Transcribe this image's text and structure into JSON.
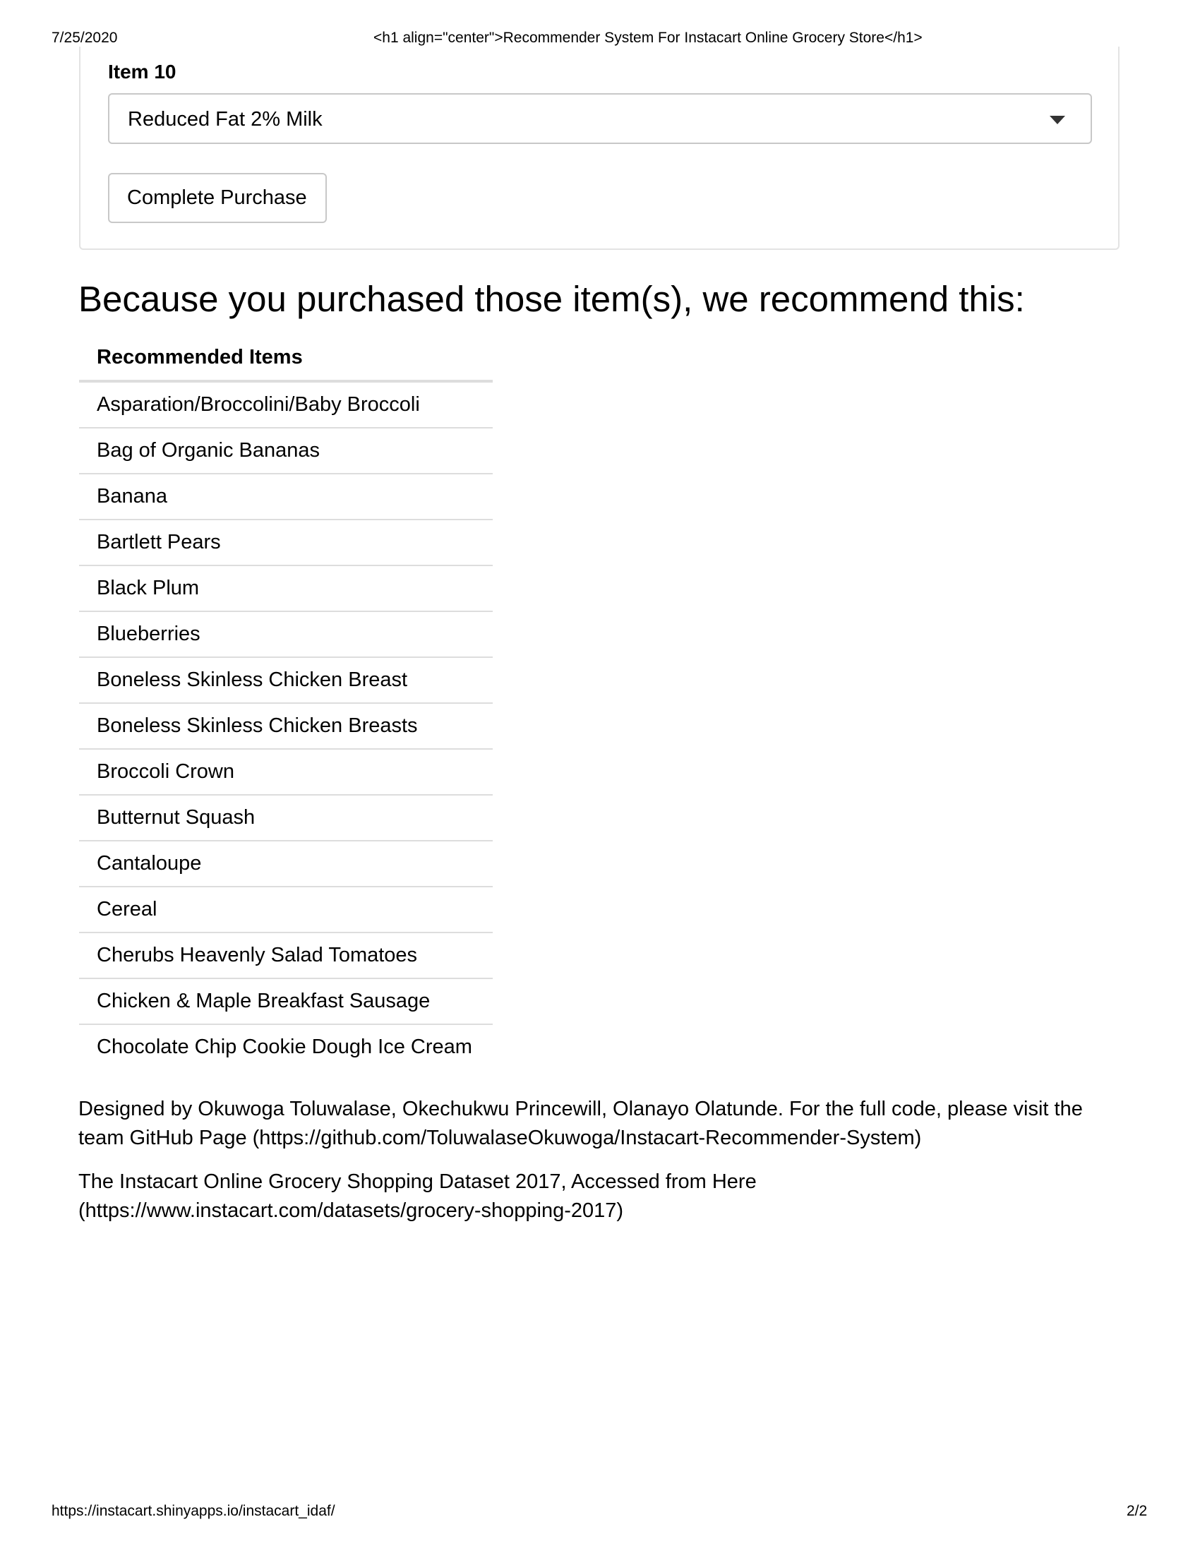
{
  "print_header": {
    "date": "7/25/2020",
    "title": "<h1 align=\"center\">Recommender System For Instacart Online Grocery Store</h1>"
  },
  "form": {
    "item_label": "Item 10",
    "item_select_value": "Reduced Fat 2% Milk",
    "purchase_button_label": "Complete Purchase"
  },
  "recommendations": {
    "heading": "Because you purchased those item(s), we recommend this:",
    "column_header": "Recommended Items",
    "items": [
      "Asparation/Broccolini/Baby Broccoli",
      "Bag of Organic Bananas",
      "Banana",
      "Bartlett Pears",
      "Black Plum",
      "Blueberries",
      "Boneless Skinless Chicken Breast",
      "Boneless Skinless Chicken Breasts",
      "Broccoli Crown",
      "Butternut Squash",
      "Cantaloupe",
      "Cereal",
      "Cherubs Heavenly Salad Tomatoes",
      "Chicken & Maple Breakfast Sausage",
      "Chocolate Chip Cookie Dough Ice Cream"
    ]
  },
  "footer": {
    "credits": "Designed by Okuwoga Toluwalase, Okechukwu Princewill, Olanayo Olatunde. For the full code, please visit the team GitHub Page (https://github.com/ToluwalaseOkuwoga/Instacart-Recommender-System)",
    "dataset": "The Instacart Online Grocery Shopping Dataset 2017, Accessed from Here (https://www.instacart.com/datasets/grocery-shopping-2017)"
  },
  "print_footer": {
    "url": "https://instacart.shinyapps.io/instacart_idaf/",
    "page_number": "2/2"
  }
}
